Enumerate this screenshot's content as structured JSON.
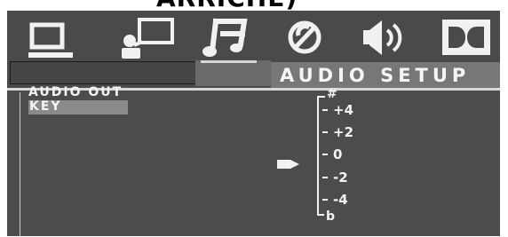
{
  "clipped_title": "ARRICHE)",
  "header": {
    "title": "AUDIO SETUP"
  },
  "menu": {
    "items": [
      {
        "label": "AUDIO OUT",
        "selected": false
      },
      {
        "label": "KEY",
        "selected": true
      }
    ]
  },
  "tabs": [
    {
      "name": "computer-icon",
      "selected": false
    },
    {
      "name": "user-monitor-icon",
      "selected": false
    },
    {
      "name": "music-note-icon",
      "selected": true
    },
    {
      "name": "round-knob-icon",
      "selected": false
    },
    {
      "name": "speaker-icon",
      "selected": false
    },
    {
      "name": "double-d-icon",
      "selected": false
    }
  ],
  "key_scale": {
    "top": "#",
    "bottom": "b",
    "values": [
      "+4",
      "+2",
      "0",
      "-2",
      "-4"
    ],
    "current": "0"
  },
  "colors": {
    "panel": "#4c4c4c",
    "header_band": "#777777",
    "highlight": "#8a8a8a",
    "text": "#f4f4f4"
  }
}
